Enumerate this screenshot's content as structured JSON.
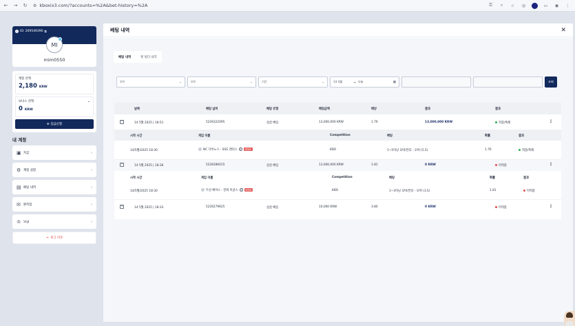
{
  "browser": {
    "url": "kboxix3.com/?accounts=%2A&bet-history=%2A",
    "icons": [
      "back-icon",
      "forward-icon",
      "reload-icon",
      "site-settings-icon",
      "key-icon",
      "zoom-icon",
      "star-icon",
      "extension-icon",
      "puzzle-icon",
      "sidepanel-icon",
      "profile-icon",
      "more-icon"
    ]
  },
  "profile": {
    "id_label": "ID: 269549390",
    "avatar_initials": "MI",
    "username": "mim0550"
  },
  "balance": {
    "main_label": "계정 잔액",
    "main_value": "2,180",
    "main_currency": "KRW",
    "bonus_label": "보너스 잔액",
    "bonus_value": "0",
    "bonus_currency": "KRW",
    "deposit_label": "입금신청"
  },
  "account_menu": {
    "title": "내 계정",
    "items": [
      {
        "label": "지갑",
        "icon": "wallet-icon"
      },
      {
        "label": "계정 설정",
        "icon": "settings-icon"
      },
      {
        "label": "베팅 내역",
        "icon": "history-icon"
      },
      {
        "label": "환지함",
        "icon": "inbox-icon"
      },
      {
        "label": "보급",
        "icon": "gift-icon"
      }
    ],
    "logout_label": "로그 아웃"
  },
  "main": {
    "title": "베팅 내역",
    "tabs": [
      {
        "label": "베팅 내역",
        "active": true
      },
      {
        "label": "벳 빌더 내역",
        "active": false
      }
    ],
    "filters": {
      "f1": "모두",
      "f2": "모두",
      "f3": "기간",
      "date_from": "14 4월",
      "date_to": "오늘",
      "search_label": "조회"
    }
  },
  "table": {
    "headers": [
      "날짜",
      "베팅 넘버",
      "베팅 유형",
      "베팅금액",
      "배당",
      "결과",
      "결과"
    ],
    "sub_headers": [
      "시작 시간",
      "게임 이름",
      "Competition",
      "베팅",
      "확률",
      "결과"
    ],
    "rows": [
      {
        "date": "14 5월 2025 | 18:51",
        "bet_no": "5226322095",
        "type": "싱글 베팅",
        "amount": "13,000,000 KRW",
        "odds": "1.76",
        "payout": "13,000,000 KRW",
        "status": "적중/특례",
        "expanded": true,
        "detail": {
          "start": "14/5월/2025 18:30",
          "game": "NC 다이노스 - SSG 랜더스",
          "live": "라이브",
          "competition": "KBO",
          "bet": "1~5이닝 오버/언더 - 오버 (5.5)",
          "prob": "1.76",
          "result": "적중/특례"
        }
      },
      {
        "date": "14 5월 2025 | 18:36",
        "bet_no": "5226286015",
        "type": "싱글 베팅",
        "amount": "13,000,000 KRW",
        "odds": "1.81",
        "payout": "0 KRW",
        "status": "미적중",
        "expanded": true,
        "detail": {
          "start": "14/5월/2025 18:30",
          "game": "두산 베어스 - 한화 이글스",
          "live": "라이브",
          "competition": "KBO",
          "bet": "1~3이닝 오버/언더 - 오버 (3.5)",
          "prob": "1.81",
          "result": "미적중"
        }
      },
      {
        "date": "14 5월 2025 | 18:33",
        "bet_no": "5226279625",
        "type": "싱글 베팅",
        "amount": "10,000 KRW",
        "odds": "3.80",
        "payout": "0 KRW",
        "status": "미적중",
        "expanded": false
      }
    ]
  },
  "colors": {
    "navy": "#12295c",
    "win": "#2eaf4f",
    "lose": "#e04b4b"
  }
}
